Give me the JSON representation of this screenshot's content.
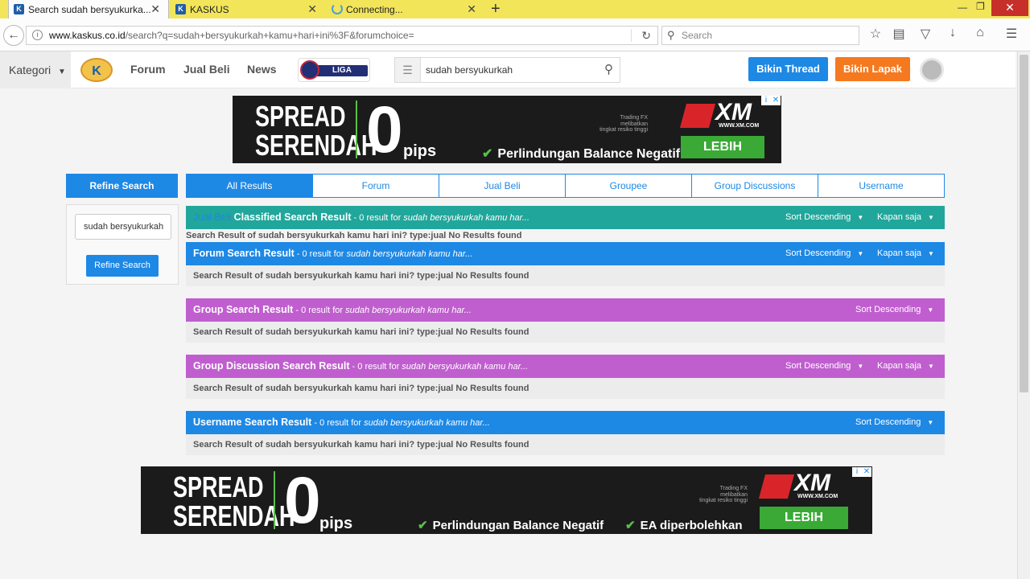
{
  "browser": {
    "tabs": [
      {
        "title": "Search sudah bersyukurka...",
        "favicon": "K"
      },
      {
        "title": "KASKUS",
        "favicon": "K"
      },
      {
        "title": "Connecting...",
        "favicon": ""
      }
    ],
    "tab_close": "✕",
    "new_tab": "+",
    "url_host": "www.kaskus.co.id",
    "url_path": "/search?q=sudah+bersyukurkah+kamu+hari+ini%3F&forumchoice=",
    "search_placeholder": "Search",
    "icons": [
      "back-icon",
      "info-icon",
      "reload-icon",
      "search-icon",
      "bookmark-star-icon",
      "reading-list-icon",
      "pocket-icon",
      "download-icon",
      "home-icon",
      "menu-icon"
    ]
  },
  "header": {
    "kategori": "Kategori",
    "nav": [
      "Forum",
      "Jual Beli",
      "News"
    ],
    "liga_label": "LIGA INGGRIS",
    "search_value": "sudah bersyukurkah",
    "bikin_thread": "Bikin Thread",
    "bikin_lapak": "Bikin Lapak"
  },
  "ads": {
    "spread": "SPREAD",
    "serendah": "SERENDAH",
    "zero": "0",
    "pips": "pips",
    "feature1": "Perlindungan Balance Negatif",
    "feature2": "EA diperbolehkan",
    "brand": "XM",
    "brand_url": "WWW.XM.COM",
    "risk_line1": "Trading FX melibatkan",
    "risk_line2": "tingkat resiko tinggi",
    "cta": "LEBIH LANJUT"
  },
  "sidebar": {
    "heading": "Refine Search",
    "input_value": "sudah bersyukurkah",
    "button": "Refine Search"
  },
  "search_tabs": [
    "All Results",
    "Forum",
    "Jual Beli",
    "Groupee",
    "Group Discussions",
    "Username"
  ],
  "results": {
    "jual_beli": {
      "prefix": "Jual Beli",
      "title": "Classified Search Result",
      "count": " - 0 result for ",
      "query": "sudah bersyukurkah kamu har...",
      "sort": "Sort Descending",
      "time": "Kapan saja",
      "message": "Search Result of sudah bersyukurkah kamu hari ini? type:jual No Results found",
      "color": "#21a69b"
    },
    "forum": {
      "title": "Forum Search Result",
      "count": " - 0 result for ",
      "query": "sudah bersyukurkah kamu har...",
      "sort": "Sort Descending",
      "time": "Kapan saja",
      "message": "Search Result of sudah bersyukurkah kamu hari ini? type:jual No Results found",
      "color": "#1e88e5"
    },
    "group": {
      "title": "Group Search Result",
      "count": " - 0 result for ",
      "query": "sudah bersyukurkah kamu har...",
      "sort": "Sort Descending",
      "message": "Search Result of sudah bersyukurkah kamu hari ini? type:jual No Results found",
      "color": "#c05ecf"
    },
    "group_discussion": {
      "title": "Group Discussion Search Result",
      "count": " - 0 result for ",
      "query": "sudah bersyukurkah kamu har...",
      "sort": "Sort Descending",
      "time": "Kapan saja",
      "message": "Search Result of sudah bersyukurkah kamu hari ini? type:jual No Results found",
      "color": "#c05ecf"
    },
    "username": {
      "title": "Username Search Result",
      "count": " - 0 result for ",
      "query": "sudah bersyukurkah kamu har...",
      "sort": "Sort Descending",
      "message": "Search Result of sudah bersyukurkah kamu hari ini? type:jual No Results found",
      "color": "#1e88e5"
    }
  }
}
